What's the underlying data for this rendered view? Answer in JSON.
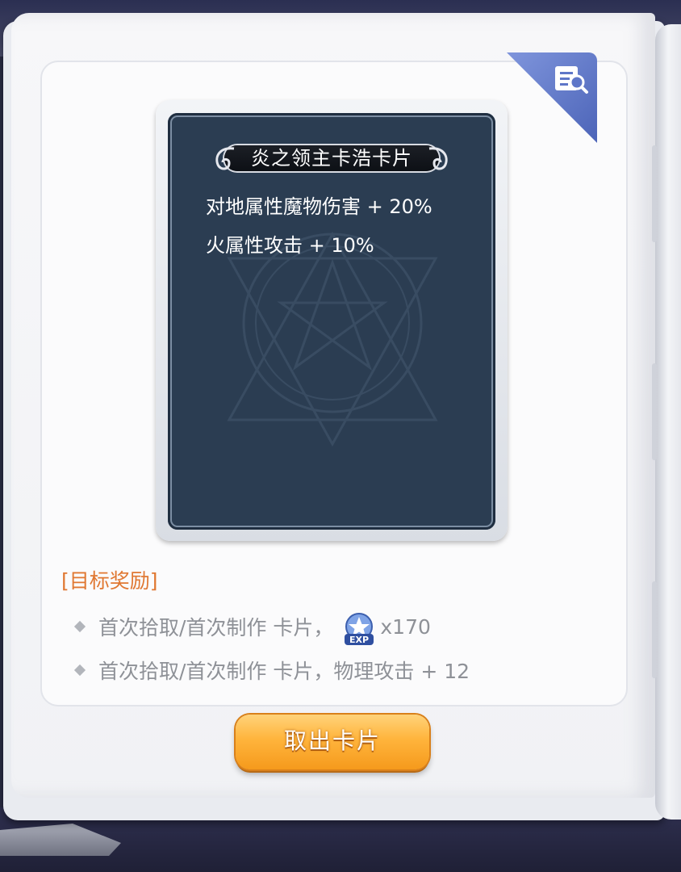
{
  "card": {
    "name": "炎之领主卡浩卡片",
    "stats": [
      {
        "text": "对地属性魔物伤害 + 20%"
      },
      {
        "text": "火属性攻击 + 10%"
      }
    ]
  },
  "rewards": {
    "header": "[目标奖励]",
    "items": [
      {
        "text": "首次拾取/首次制作 卡片，",
        "icon": "exp-icon",
        "suffix": "x170"
      },
      {
        "text": "首次拾取/首次制作 卡片，物理攻击 + 12"
      }
    ]
  },
  "actions": {
    "take_card_label": "取出卡片"
  },
  "colors": {
    "card_bg": "#2b3d52",
    "reward_header": "#e07832",
    "button": "#ffb43c",
    "corner_tag": "#5e76c8"
  },
  "icons": {
    "corner": "search-card-icon"
  }
}
